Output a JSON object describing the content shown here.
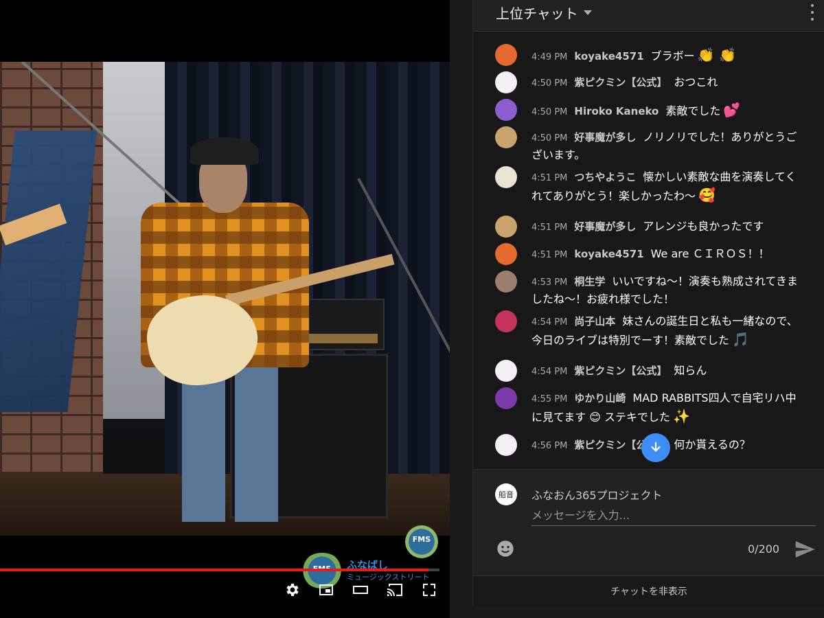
{
  "player": {
    "logo_small": "FMS",
    "logo_text_main": "ふなばし",
    "logo_text_sub": "ミュージックストリート",
    "progress_fraction": 0.975,
    "controls": [
      "settings-icon",
      "miniplayer-icon",
      "theater-mode-icon",
      "cast-icon",
      "fullscreen-icon"
    ]
  },
  "chat": {
    "title": "上位チャット",
    "messages": [
      {
        "time": "4:49 PM",
        "author": "koyake4571",
        "text": "ブラボー",
        "emoji": "👏 👏",
        "avatar_color": "#e46a2f"
      },
      {
        "time": "4:50 PM",
        "author": "紫ピクミン【公式】",
        "text": "おつこれ",
        "emoji": "",
        "avatar_color": "#f4f0f6"
      },
      {
        "time": "4:50 PM",
        "author": "Hiroko Kaneko",
        "text": "素敵でした",
        "emoji": "💕",
        "avatar_color": "#8b5fd0"
      },
      {
        "time": "4:50 PM",
        "author": "好事魔が多し",
        "text": "ノリノリでした！ありがとうございます。",
        "emoji": "",
        "avatar_color": "#c9a26c"
      },
      {
        "time": "4:51 PM",
        "author": "つちやようこ",
        "text": "懐かしい素敵な曲を演奏してくれてありがとう！楽しかったわ〜",
        "emoji": "🥰",
        "avatar_color": "#e9e3d3"
      },
      {
        "time": "4:51 PM",
        "author": "好事魔が多し",
        "text": "アレンジも良かったです",
        "emoji": "",
        "avatar_color": "#c9a26c"
      },
      {
        "time": "4:51 PM",
        "author": "koyake4571",
        "text": "We are ＣＩＲＯＳ！！",
        "emoji": "",
        "avatar_color": "#e46a2f"
      },
      {
        "time": "4:53 PM",
        "author": "桐生学",
        "text": "いいですね〜！演奏も熟成されてきましたね〜！お疲れ様でした！",
        "emoji": "",
        "avatar_color": "#9a7f6c"
      },
      {
        "time": "4:54 PM",
        "author": "尚子山本",
        "text": "妹さんの誕生日と私も一緒なので、今日のライブは特別でーす！素敵でした",
        "emoji": "🎵",
        "avatar_color": "#c2345b"
      },
      {
        "time": "4:54 PM",
        "author": "紫ピクミン【公式】",
        "text": "知らん",
        "emoji": "",
        "avatar_color": "#f4f0f6"
      },
      {
        "time": "4:55 PM",
        "author": "ゆかり山崎",
        "text": "MAD RABBITS四人で自宅リハ中に見てます 😊 ステキでした",
        "emoji": "✨",
        "avatar_color": "#7a3aa8"
      },
      {
        "time": "4:56 PM",
        "author": "紫ピクミン【公式】",
        "text": "何か貰えるの？",
        "emoji": "",
        "avatar_color": "#f4f0f6"
      }
    ],
    "composer": {
      "channel_name": "ふなおん365プロジェクト",
      "avatar_text": "船音",
      "placeholder": "メッセージを入力...",
      "counter": "0/200"
    },
    "hide_chat": "チャットを非表示"
  }
}
